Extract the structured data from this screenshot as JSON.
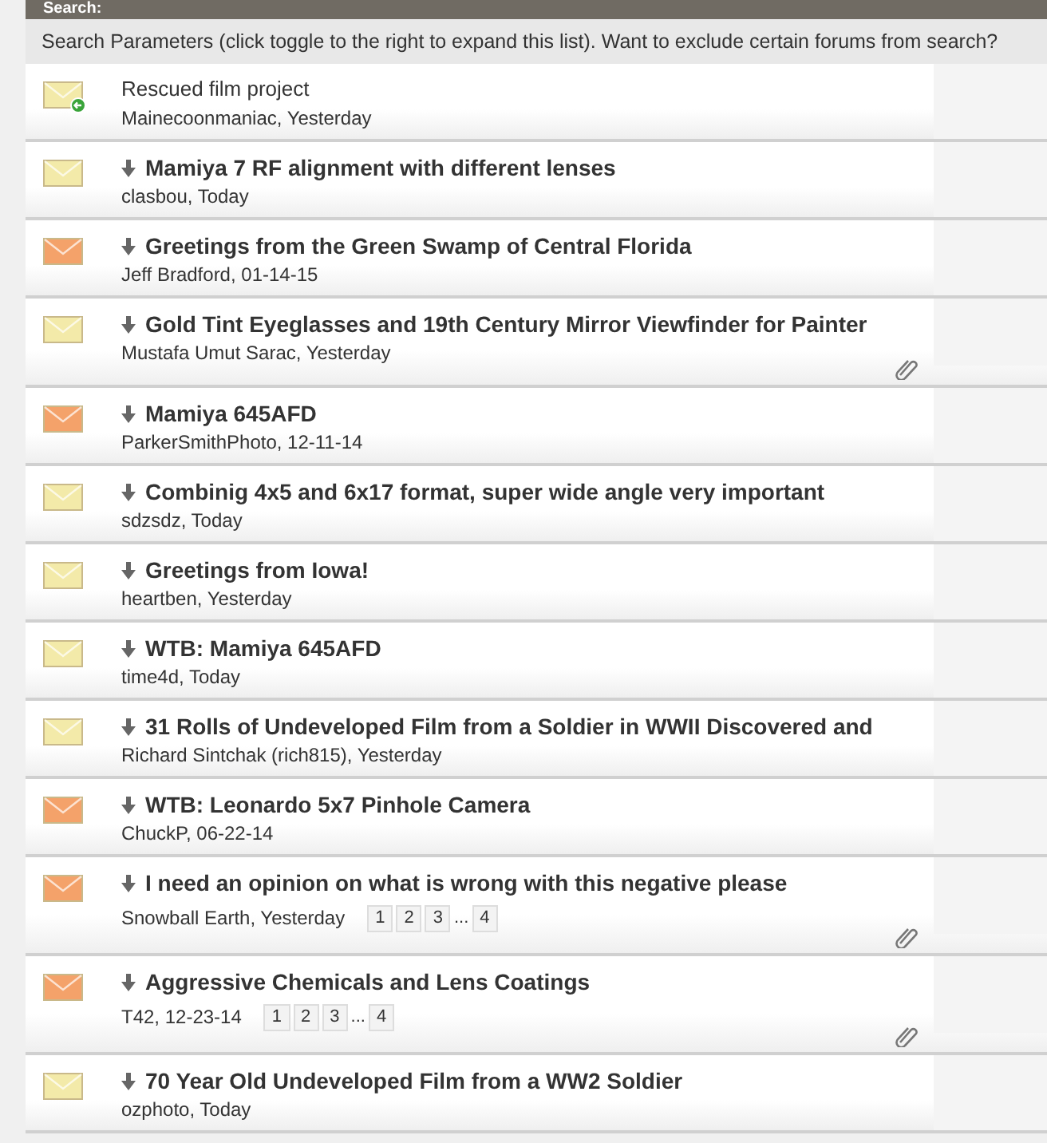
{
  "header": {
    "title": "Search:"
  },
  "search_parameters": "Search Parameters (click toggle to the right to expand this list). Want to exclude certain forums from search?",
  "threads": [
    {
      "kind": "new_post",
      "title": "Rescued film project",
      "meta": "Mainecoonmaniac, Yesterday",
      "color": "#f3eaa9",
      "attachment": false
    },
    {
      "kind": "thread",
      "title": "Mamiya 7 RF alignment with different lenses",
      "meta": "clasbou, Today",
      "color": "#f3eaa9",
      "attachment": false
    },
    {
      "kind": "thread",
      "title": "Greetings from the Green Swamp of Central Florida",
      "meta": "Jeff Bradford, 01-14-15",
      "color": "#f4a26a",
      "attachment": false
    },
    {
      "kind": "thread",
      "title": "Gold Tint Eyeglasses and 19th Century Mirror Viewfinder for Painter",
      "meta": "Mustafa Umut Sarac, Yesterday",
      "color": "#f3eaa9",
      "attachment": true
    },
    {
      "kind": "thread",
      "title": "Mamiya 645AFD",
      "meta": "ParkerSmithPhoto, 12-11-14",
      "color": "#f4a26a",
      "attachment": false
    },
    {
      "kind": "thread",
      "title": "Combinig 4x5 and 6x17 format, super wide angle very important",
      "meta": "sdzsdz, Today",
      "color": "#f3eaa9",
      "attachment": false
    },
    {
      "kind": "thread",
      "title": "Greetings from Iowa!",
      "meta": "heartben, Yesterday",
      "color": "#f3eaa9",
      "attachment": false
    },
    {
      "kind": "thread",
      "title": "WTB: Mamiya 645AFD",
      "meta": "time4d, Today",
      "color": "#f3eaa9",
      "attachment": false
    },
    {
      "kind": "thread",
      "title": "31 Rolls of Undeveloped Film from a Soldier in WWII Discovered and",
      "meta": "Richard Sintchak (rich815), Yesterday",
      "color": "#f3eaa9",
      "attachment": false
    },
    {
      "kind": "thread",
      "title": "WTB: Leonardo 5x7 Pinhole Camera",
      "meta": "ChuckP, 06-22-14",
      "color": "#f4a26a",
      "attachment": false
    },
    {
      "kind": "thread",
      "title": "I need an opinion on what is wrong with this negative please",
      "meta": "Snowball Earth, Yesterday",
      "color": "#f4a26a",
      "attachment": true,
      "pages": [
        "1",
        "2",
        "3",
        "...",
        "4"
      ]
    },
    {
      "kind": "thread",
      "title": "Aggressive Chemicals and Lens Coatings",
      "meta": "T42, 12-23-14",
      "color": "#f4a26a",
      "attachment": true,
      "pages": [
        "1",
        "2",
        "3",
        "...",
        "4"
      ]
    },
    {
      "kind": "thread",
      "title": "70 Year Old Undeveloped Film from a WW2 Soldier",
      "meta": "ozphoto, Today",
      "color": "#f3eaa9",
      "attachment": false
    }
  ]
}
